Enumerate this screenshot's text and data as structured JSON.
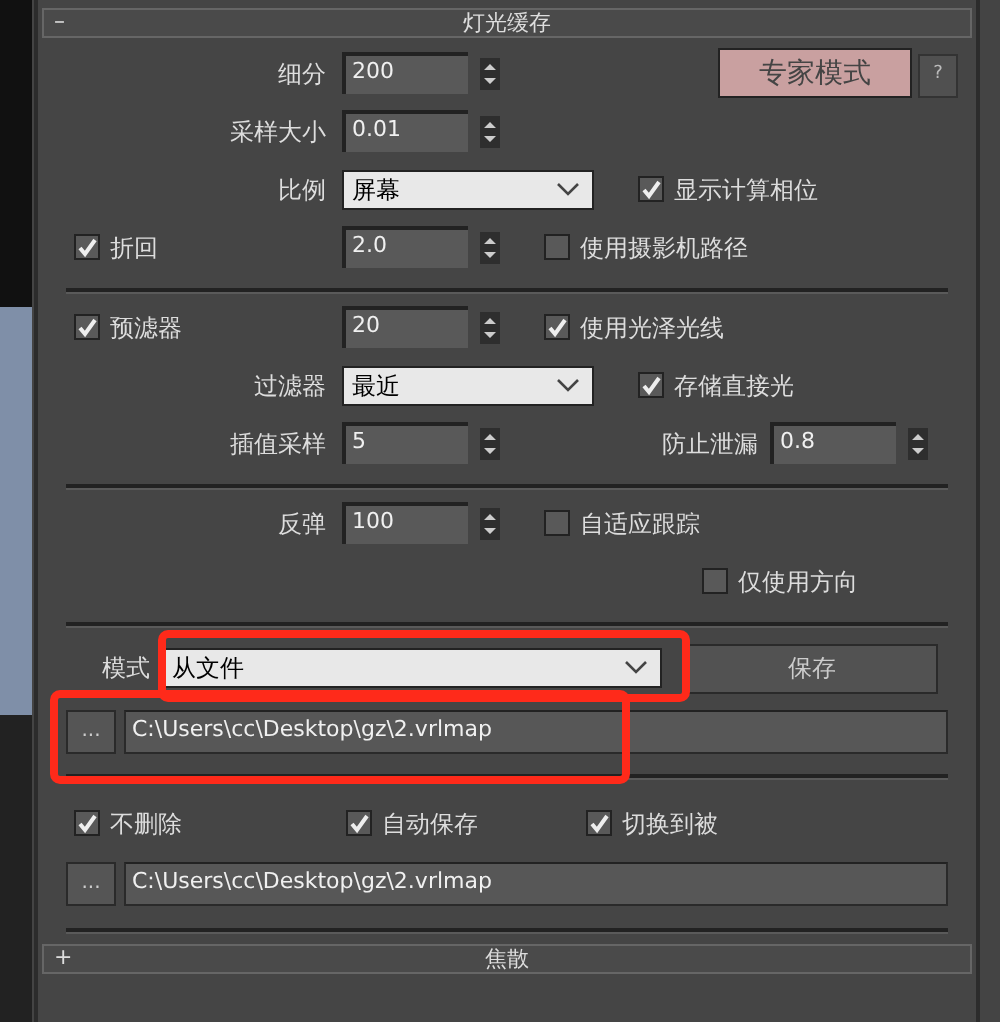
{
  "rollout": {
    "toggle": "–",
    "title": "灯光缓存"
  },
  "expert_button": "专家模式",
  "help_button": "?",
  "sections": [
    {
      "rows": [
        {
          "left": {
            "kind": "spinner",
            "label": "细分",
            "value": "200"
          }
        },
        {
          "left": {
            "kind": "spinner",
            "label": "采样大小",
            "value": "0.01"
          }
        },
        {
          "left": {
            "kind": "dropdown",
            "label": "比例",
            "value": "屏幕"
          },
          "right": {
            "kind": "check",
            "label": "显示计算相位",
            "checked": true
          }
        },
        {
          "left": {
            "kind": "spinner",
            "label": "折回",
            "value": "2.0",
            "checked": true
          },
          "right": {
            "kind": "check",
            "label": "使用摄影机路径",
            "checked": false
          }
        }
      ]
    },
    {
      "rows": [
        {
          "left": {
            "kind": "spinner",
            "label": "预滤器",
            "value": "20",
            "checked": true
          },
          "right": {
            "kind": "check",
            "label": "使用光泽光线",
            "checked": true
          }
        },
        {
          "left": {
            "kind": "dropdown",
            "label": "过滤器",
            "value": "最近"
          },
          "right": {
            "kind": "check",
            "label": "存储直接光",
            "checked": true
          }
        },
        {
          "left": {
            "kind": "spinner",
            "label": "插值采样",
            "value": "5"
          },
          "right": {
            "kind": "spinner",
            "label": "防止泄漏",
            "value": "0.8"
          }
        }
      ]
    },
    {
      "rows": [
        {
          "left": {
            "kind": "spinner",
            "label": "反弹",
            "value": "100"
          },
          "right": {
            "kind": "check",
            "label": "自适应跟踪",
            "checked": false
          }
        },
        {
          "right": {
            "kind": "check",
            "label": "仅使用方向",
            "checked": false
          }
        }
      ]
    }
  ],
  "mode": {
    "label": "模式",
    "value": "从文件",
    "highlighted": true,
    "button": "保存"
  },
  "mode_path": {
    "browse": "...",
    "value": "C:\\Users\\cc\\Desktop\\gz\\2.vrlmap",
    "highlighted": true
  },
  "options": [
    {
      "label": "不删除",
      "checked": true
    },
    {
      "label": "自动保存",
      "checked": true
    },
    {
      "label": "切换到被",
      "checked": true
    }
  ],
  "save_path": {
    "browse": "...",
    "value": "C:\\Users\\cc\\Desktop\\gz\\2.vrlmap"
  },
  "next_rollout": {
    "toggle": "+",
    "title": "焦散"
  }
}
